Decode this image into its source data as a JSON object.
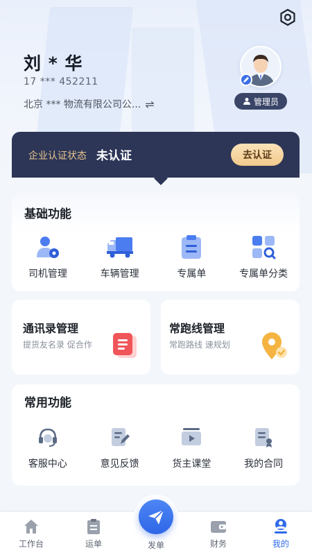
{
  "profile": {
    "name": "刘 * 华",
    "phone": "17 *** 452211",
    "company": "北京 *** 物流有限公司公...",
    "role": "管理员"
  },
  "certification": {
    "label": "企业认证状态",
    "status": "未认证",
    "action": "去认证"
  },
  "basic_functions": {
    "title": "基础功能",
    "items": [
      {
        "label": "司机管理",
        "icon": "driver-settings-icon"
      },
      {
        "label": "车辆管理",
        "icon": "truck-icon"
      },
      {
        "label": "专属单",
        "icon": "clipboard-icon"
      },
      {
        "label": "专属单分类",
        "icon": "category-grid-icon"
      }
    ]
  },
  "feature_cards": [
    {
      "title": "通讯录管理",
      "subtitle": "提货友名录 促合作",
      "icon": "document-icon"
    },
    {
      "title": "常跑线管理",
      "subtitle": "常跑路线 速规划",
      "icon": "location-pin-icon"
    }
  ],
  "common_functions": {
    "title": "常用功能",
    "items": [
      {
        "label": "客服中心",
        "icon": "headset-icon"
      },
      {
        "label": "意见反馈",
        "icon": "feedback-edit-icon"
      },
      {
        "label": "货主课堂",
        "icon": "video-play-icon"
      },
      {
        "label": "我的合同",
        "icon": "contract-icon"
      }
    ]
  },
  "tabbar": {
    "items": [
      {
        "label": "工作台",
        "icon": "home-icon"
      },
      {
        "label": "运单",
        "icon": "waybill-icon"
      },
      {
        "label": "发单",
        "icon": "send-plane-icon"
      },
      {
        "label": "财务",
        "icon": "wallet-icon"
      },
      {
        "label": "我的",
        "icon": "user-icon"
      }
    ],
    "active": "我的"
  },
  "colors": {
    "accent": "#2f6bea",
    "banner": "#2d3657",
    "gold": "#e9c58f"
  }
}
